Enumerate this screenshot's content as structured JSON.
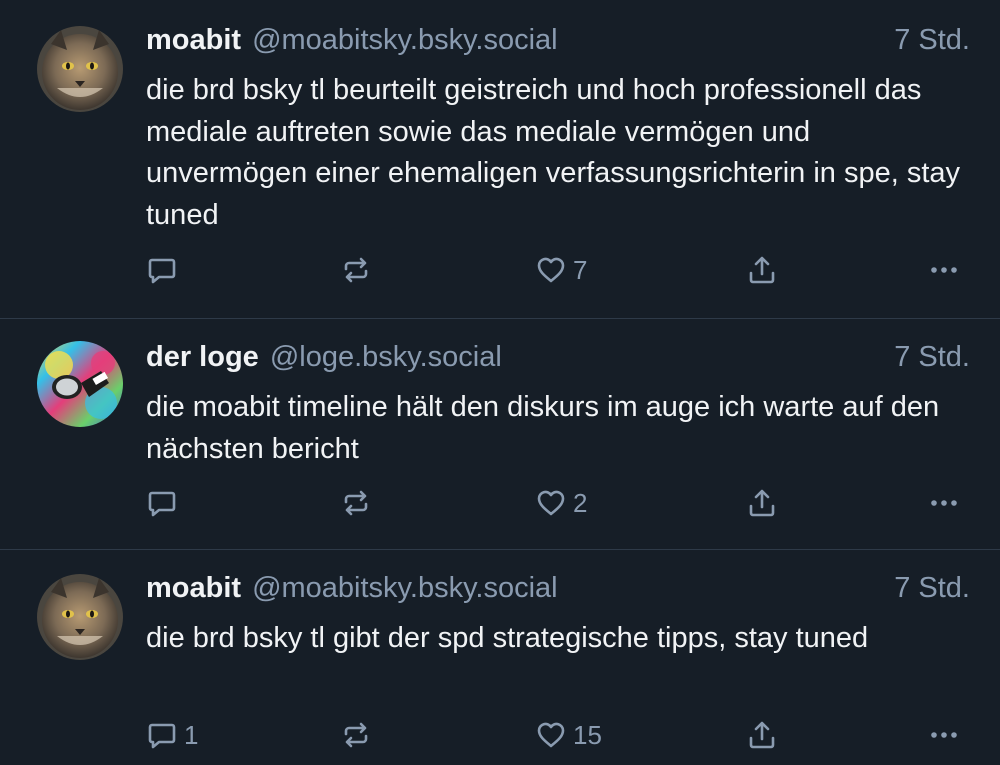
{
  "colors": {
    "background": "#161e27",
    "divider": "#2e3a48",
    "text": "#f1f3f5",
    "muted": "#8a9bb0"
  },
  "posts": [
    {
      "author_name": "moabit",
      "handle": "@moabitsky.bsky.social",
      "time": "7 Std.",
      "avatar": "lynx-avatar",
      "text": "die brd bsky tl beurteilt geistreich und hoch professionell das mediale auftreten sowie das mediale vermögen und unvermögen einer ehemaligen verfassungsrichterin in spe, stay tuned",
      "reply_count": "",
      "repost_count": "",
      "like_count": "7"
    },
    {
      "author_name": "der loge",
      "handle": "@loge.bsky.social",
      "time": "7 Std.",
      "avatar": "colorful-sunglasses-avatar",
      "text": "die moabit timeline hält den diskurs im auge ich warte auf den nächsten bericht",
      "reply_count": "",
      "repost_count": "",
      "like_count": "2"
    },
    {
      "author_name": "moabit",
      "handle": "@moabitsky.bsky.social",
      "time": "7 Std.",
      "avatar": "lynx-avatar",
      "text": "die brd bsky tl gibt der spd strategische tipps, stay tuned",
      "reply_count": "1",
      "repost_count": "",
      "like_count": "15"
    }
  ],
  "icons": {
    "reply": "speech-bubble-icon",
    "repost": "repost-arrows-icon",
    "like": "heart-icon",
    "share": "share-upload-icon",
    "more": "ellipsis-icon"
  }
}
